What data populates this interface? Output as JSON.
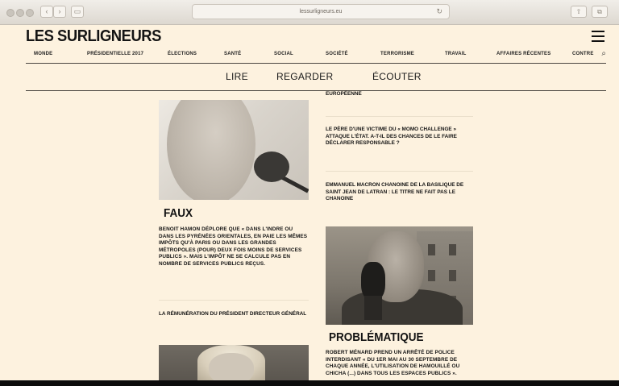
{
  "browser": {
    "url": "lessurligneurs.eu"
  },
  "site": {
    "logo": "LES SURLIGNEURS",
    "categories": [
      "MONDE",
      "PRÉSIDENTIELLE 2017",
      "ÉLECTIONS",
      "SANTÉ",
      "SOCIAL",
      "SOCIÉTÉ",
      "TERRORISME",
      "TRAVAIL",
      "AFFAIRES RÉCENTES",
      "CONTRE"
    ],
    "main_nav": [
      "LIRE",
      "REGARDER",
      "ÉCOUTER"
    ]
  },
  "articles": {
    "left": {
      "verdict": "FAUX",
      "text": "BENOIT HAMON DÉPLORE QUE « DANS L'INDRE OU DANS LES PYRÉNÉES ORIENTALES, EN PAIE LES MÊMES IMPÔTS QU'À PARIS OU DANS LES GRANDES MÉTROPOLES (POUR) DEUX FOIS MOINS DE SERVICES PUBLICS ». MAIS L'IMPÔT NE SE CALCULE PAS EN NOMBRE DE SERVICES PUBLICS REÇUS.",
      "teaser": "LA RÉMUNÉRATION DU PRÉSIDENT DIRECTEUR GÉNÉRAL"
    },
    "right": {
      "top_fragment": "EUROPÉENNE",
      "teaser1": "LE PÈRE D'UNE VICTIME DU « MOMO CHALLENGE » ATTAQUE L'ÉTAT. A-T-IL DES CHANCES DE LE FAIRE DÉCLARER RESPONSABLE ?",
      "teaser2": "EMMANUEL MACRON CHANOINE DE LA BASILIQUE DE SAINT JEAN DE LATRAN : LE TITRE NE FAIT PAS LE CHANOINE",
      "verdict": "PROBLÉMATIQUE",
      "text": "ROBERT MÉNARD PREND UN ARRÊTÉ DE POLICE INTERDISANT « DU 1ER MAI AU 30 SEPTEMBRE DE CHAQUE ANNÉE, L'UTILISATION DE HAMOUILLÉ OU CHICHA (...) DANS TOUS LES ESPACES PUBLICS »."
    }
  }
}
